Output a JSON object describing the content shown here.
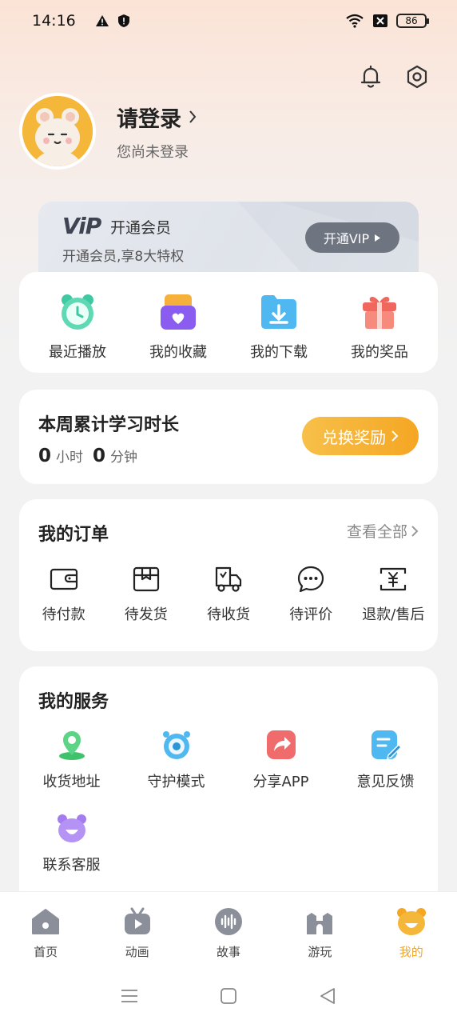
{
  "status": {
    "time": "14:16",
    "battery": "86"
  },
  "profile": {
    "login": "请登录",
    "sub": "您尚未登录"
  },
  "vip": {
    "logo": "ViP",
    "title": "开通会员",
    "sub": "开通会员,享8大特权",
    "button": "开通VIP"
  },
  "quick": [
    {
      "label": "最近播放",
      "icon": "alarm-clock-icon"
    },
    {
      "label": "我的收藏",
      "icon": "favorites-box-icon"
    },
    {
      "label": "我的下载",
      "icon": "download-folder-icon"
    },
    {
      "label": "我的奖品",
      "icon": "gift-icon"
    }
  ],
  "study": {
    "title": "本周累计学习时长",
    "hours": "0",
    "hours_unit": "小时",
    "minutes": "0",
    "minutes_unit": "分钟",
    "button": "兑换奖励"
  },
  "orders": {
    "title": "我的订单",
    "view_all": "查看全部",
    "items": [
      {
        "label": "待付款",
        "icon": "wallet-icon"
      },
      {
        "label": "待发货",
        "icon": "package-icon"
      },
      {
        "label": "待收货",
        "icon": "truck-icon"
      },
      {
        "label": "待评价",
        "icon": "comment-icon"
      },
      {
        "label": "退款/售后",
        "icon": "refund-icon"
      }
    ]
  },
  "services": {
    "title": "我的服务",
    "items": [
      {
        "label": "收货地址",
        "icon": "location-pin-icon"
      },
      {
        "label": "守护模式",
        "icon": "eye-guard-icon"
      },
      {
        "label": "分享APP",
        "icon": "share-icon"
      },
      {
        "label": "意见反馈",
        "icon": "feedback-icon"
      },
      {
        "label": "联系客服",
        "icon": "customer-service-icon"
      }
    ]
  },
  "tabs": [
    {
      "label": "首页",
      "icon": "home-icon"
    },
    {
      "label": "动画",
      "icon": "animation-tv-icon"
    },
    {
      "label": "故事",
      "icon": "audio-story-icon"
    },
    {
      "label": "游玩",
      "icon": "castle-icon"
    },
    {
      "label": "我的",
      "icon": "bear-profile-icon",
      "active": true
    }
  ],
  "colors": {
    "accent": "#f5a623",
    "vip_button": "#6e7480"
  }
}
